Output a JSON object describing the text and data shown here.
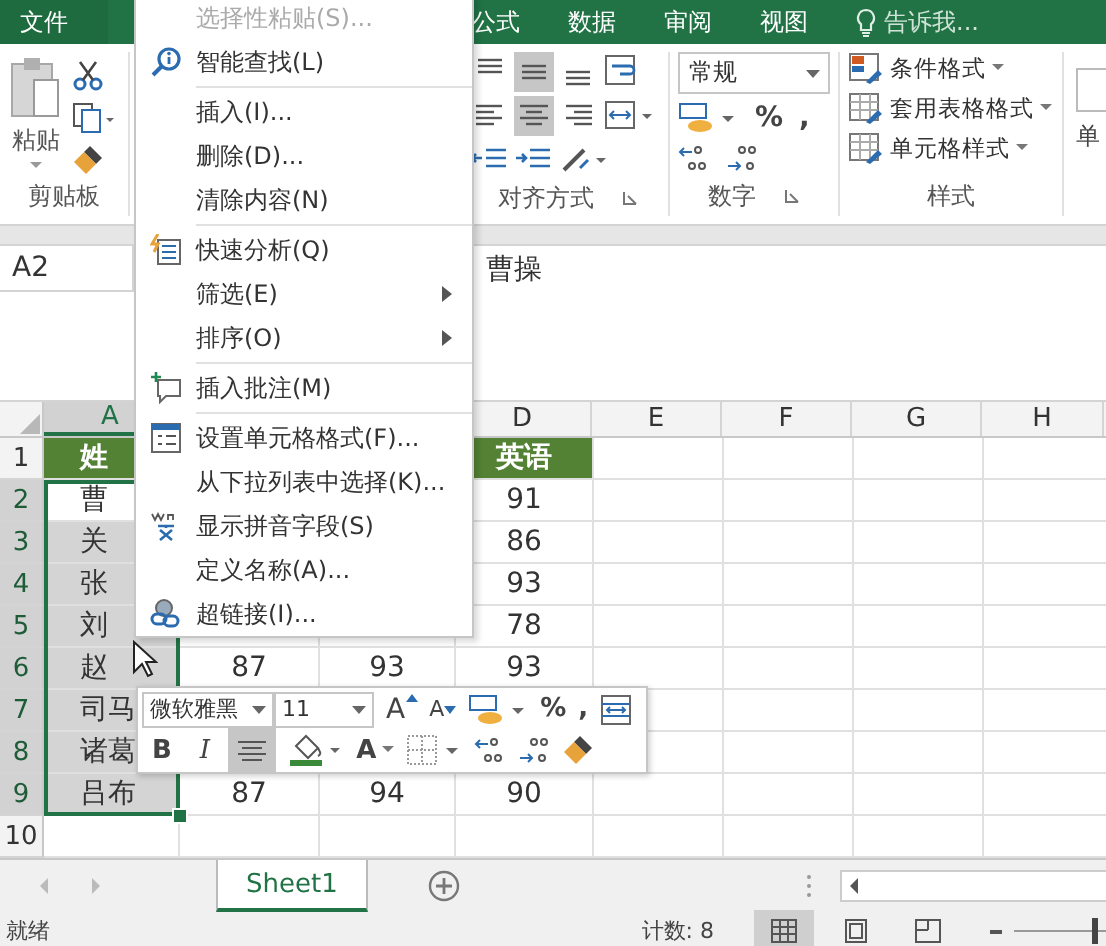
{
  "ribbon_tabs": [
    {
      "label": "文件",
      "kind": "file"
    },
    {
      "label": "公式",
      "kind": "tab"
    },
    {
      "label": "数据",
      "kind": "tab"
    },
    {
      "label": "审阅",
      "kind": "tab"
    },
    {
      "label": "视图",
      "kind": "tab"
    },
    {
      "label": "告诉我...",
      "kind": "search"
    }
  ],
  "ribbon": {
    "clipboard": {
      "paste_label": "粘贴",
      "group_label": "剪贴板"
    },
    "alignment": {
      "group_label": "对齐方式",
      "buttons": [
        {
          "selected": false
        },
        {
          "selected": true
        },
        {
          "selected": false
        },
        {
          "selected": false
        },
        {
          "selected": true
        },
        {
          "selected": false
        }
      ]
    },
    "number": {
      "format": "常规",
      "percent": "%",
      "comma": ",",
      "group_label": "数字"
    },
    "styles": {
      "items": [
        "条件格式",
        "套用表格格式",
        "单元格样式"
      ],
      "group_label": "样式"
    },
    "cells": {
      "label": "单"
    }
  },
  "name_box": "A2",
  "formula": "曹操",
  "columns": [
    "A",
    null,
    null,
    "D",
    "E",
    "F",
    "G",
    "H"
  ],
  "rows": [
    {
      "number": "1",
      "kind": "header",
      "selected": false,
      "cells": [
        "姓",
        null,
        null,
        "英语"
      ]
    },
    {
      "number": "2",
      "kind": "data",
      "selected": true,
      "cells": [
        "曹",
        null,
        null,
        "91"
      ]
    },
    {
      "number": "3",
      "kind": "data",
      "selected": true,
      "cells": [
        "关",
        null,
        null,
        "86"
      ]
    },
    {
      "number": "4",
      "kind": "data",
      "selected": true,
      "cells": [
        "张",
        null,
        null,
        "93"
      ]
    },
    {
      "number": "5",
      "kind": "data",
      "selected": true,
      "cells": [
        "刘",
        null,
        null,
        "78"
      ]
    },
    {
      "number": "6",
      "kind": "data",
      "selected": true,
      "cells": [
        "赵",
        "87",
        "93",
        "93"
      ]
    },
    {
      "number": "7",
      "kind": "data",
      "selected": true,
      "cells": [
        "司马"
      ]
    },
    {
      "number": "8",
      "kind": "data",
      "selected": true,
      "cells": [
        "诸葛"
      ]
    },
    {
      "number": "9",
      "kind": "data",
      "selected": true,
      "cells": [
        "吕布",
        "87",
        "94",
        "90"
      ]
    },
    {
      "number": "10",
      "kind": "data",
      "selected": false,
      "cells": []
    }
  ],
  "context_menu": {
    "groups": [
      [
        {
          "label": "选择性粘贴(S)...",
          "disabled": true,
          "submenu": false
        },
        {
          "label": "智能查找(L)",
          "disabled": false,
          "submenu": false
        }
      ],
      [
        {
          "label": "插入(I)...",
          "disabled": false,
          "submenu": false
        },
        {
          "label": "删除(D)...",
          "disabled": false,
          "submenu": false
        },
        {
          "label": "清除内容(N)",
          "disabled": false,
          "submenu": false
        }
      ],
      [
        {
          "label": "快速分析(Q)",
          "disabled": false,
          "submenu": false
        },
        {
          "label": "筛选(E)",
          "disabled": false,
          "submenu": true
        },
        {
          "label": "排序(O)",
          "disabled": false,
          "submenu": true
        }
      ],
      [
        {
          "label": "插入批注(M)",
          "disabled": false,
          "submenu": false
        }
      ],
      [
        {
          "label": "设置单元格格式(F)...",
          "disabled": false,
          "submenu": false
        },
        {
          "label": "从下拉列表中选择(K)...",
          "disabled": false,
          "submenu": false
        },
        {
          "label": "显示拼音字段(S)",
          "disabled": false,
          "submenu": false
        },
        {
          "label": "定义名称(A)...",
          "disabled": false,
          "submenu": false
        },
        {
          "label": "超链接(I)...",
          "disabled": false,
          "submenu": false
        }
      ]
    ]
  },
  "mini_toolbar": {
    "font": "微软雅黑",
    "size": "11",
    "grow_font": "A",
    "shrink_font": "A",
    "percent": "%",
    "comma": ",",
    "bold": "B",
    "italic": "I",
    "font_color": "A",
    "center_align": {
      "selected": true
    }
  },
  "sheet_tabs": [
    {
      "label": "Sheet1",
      "selected": true
    }
  ],
  "status_bar": {
    "state": "就绪",
    "count": "计数: 8",
    "views": [
      {
        "selected": true
      },
      {
        "selected": false
      },
      {
        "selected": false
      }
    ],
    "zoom": {
      "level": 0.9
    }
  }
}
